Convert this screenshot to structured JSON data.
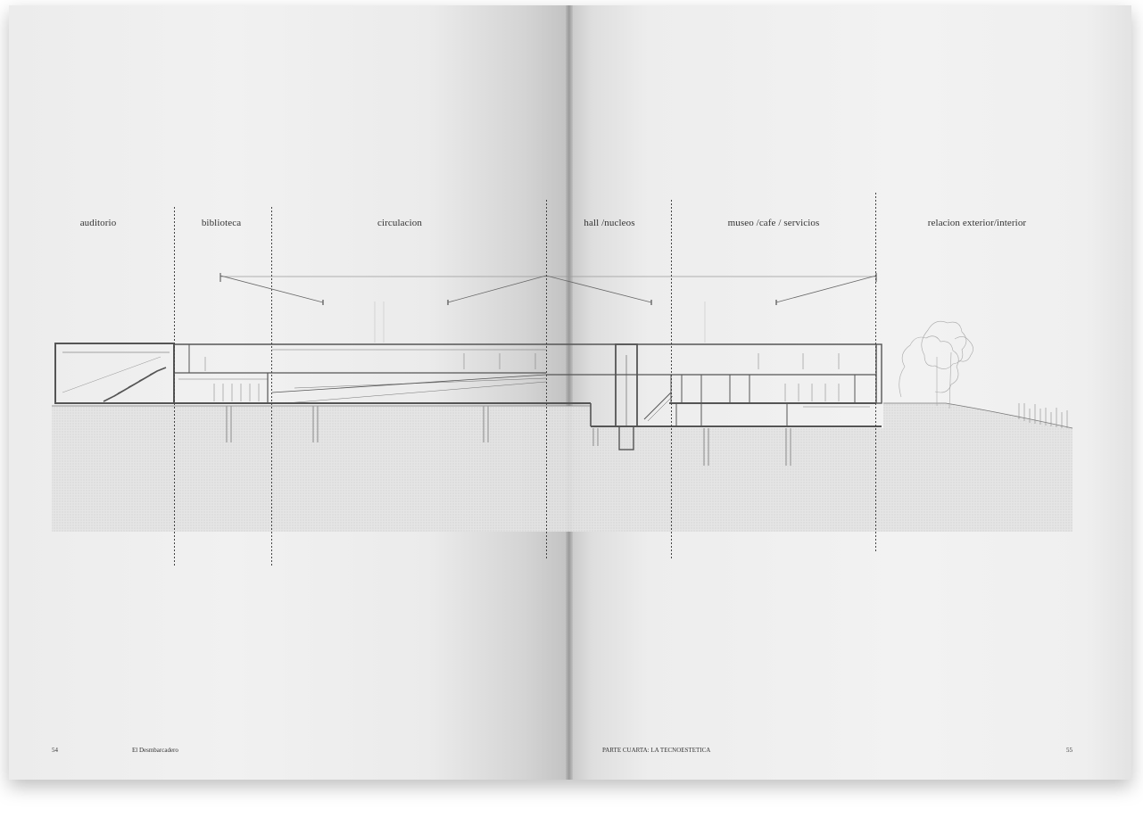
{
  "left_page": {
    "page_number": "54",
    "running_title": "El Desmbarcadero"
  },
  "right_page": {
    "page_number": "55",
    "running_title": "PARTE CUARTA: LA TECNOESTETICA"
  },
  "section_drawing": {
    "zones": [
      {
        "id": "auditorio",
        "label": "auditorio"
      },
      {
        "id": "biblioteca",
        "label": "biblioteca"
      },
      {
        "id": "circulacion",
        "label": "circulacion"
      },
      {
        "id": "hall",
        "label": "hall /nucleos"
      },
      {
        "id": "museo",
        "label": "museo /cafe / servicios"
      },
      {
        "id": "relacion",
        "label": "relacion exterior/interior"
      }
    ]
  }
}
